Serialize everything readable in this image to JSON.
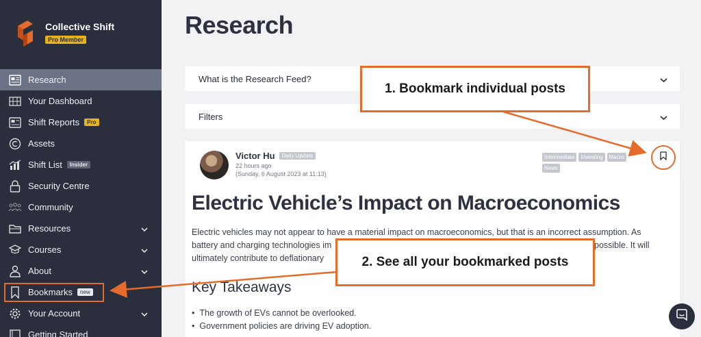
{
  "brand": {
    "name": "Collective Shift",
    "badge": "Pro Member"
  },
  "sidebar": {
    "items": [
      {
        "label": "Research",
        "icon": "news-icon",
        "active": true
      },
      {
        "label": "Your Dashboard",
        "icon": "dashboard-icon"
      },
      {
        "label": "Shift Reports",
        "icon": "report-icon",
        "tag": "Pro"
      },
      {
        "label": "Assets",
        "icon": "copyright-icon"
      },
      {
        "label": "Shift List",
        "icon": "chart-icon",
        "tag": "Insider"
      },
      {
        "label": "Security Centre",
        "icon": "lock-icon"
      },
      {
        "label": "Community",
        "icon": "people-icon"
      },
      {
        "label": "Resources",
        "icon": "folder-icon"
      },
      {
        "label": "Courses",
        "icon": "graduation-cap-icon"
      },
      {
        "label": "About",
        "icon": "person-icon"
      },
      {
        "label": "Bookmarks",
        "icon": "bookmark-icon",
        "tag": "new"
      },
      {
        "label": "Your Account",
        "icon": "gear-icon"
      },
      {
        "label": "Getting Started",
        "icon": "book-icon"
      }
    ]
  },
  "main": {
    "title": "Research",
    "accordions": [
      "What is the Research Feed?",
      "Filters"
    ],
    "post": {
      "author": "Victor Hu",
      "author_tag": "Daily Update",
      "time_ago": "22 hours ago",
      "timestamp": "(Sunday, 6 August 2023 at 11:13)",
      "tags": [
        "Intermediate",
        "Investing",
        "Macro",
        "News"
      ],
      "headline": "Electric Vehicle’s Impact on Macroeconomics",
      "body_line1": "Electric vehicles may not appear to have a material impact on macroeconomics, but that is an incorrect assumption. As",
      "body_line2a": "battery and charging technologies im",
      "body_line2b": "possible. It will",
      "body_line3": "ultimately contribute to deflationary",
      "subhead": "Key Takeaways",
      "bullets": [
        "The growth of EVs cannot be overlooked.",
        "Government policies are driving EV adoption."
      ]
    }
  },
  "callouts": {
    "one": "1. Bookmark individual posts",
    "two": "2. See all your bookmarked posts"
  },
  "colors": {
    "accent": "#e46b2a",
    "sidebar_bg": "#2b2f3d",
    "pro_badge": "#e8b21c"
  }
}
